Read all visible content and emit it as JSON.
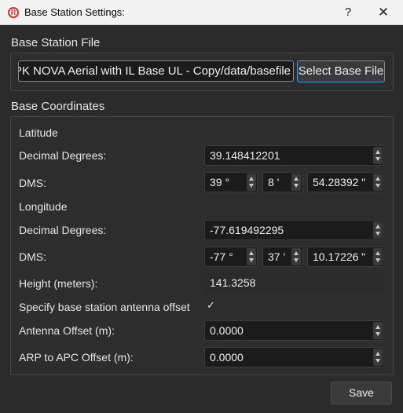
{
  "window": {
    "title": "Base Station Settings:",
    "help_glyph": "?",
    "close_glyph": "✕",
    "icon": "r-logo-icon"
  },
  "file_section": {
    "title": "Base Station File",
    "path": "PK NOVA Aerial with IL Base UL - Copy/data/basefile",
    "select_button": "Select Base File"
  },
  "coords": {
    "title": "Base Coordinates",
    "latitude": {
      "heading": "Latitude",
      "decimal_label": "Decimal Degrees:",
      "decimal_value": "39.148412201",
      "dms_label": "DMS:",
      "deg": "39 °",
      "min": "8 '",
      "sec": "54.28392 \""
    },
    "longitude": {
      "heading": "Longitude",
      "decimal_label": "Decimal Degrees:",
      "decimal_value": "-77.619492295",
      "dms_label": "DMS:",
      "deg": "-77 °",
      "min": "37 '",
      "sec": "10.17226 \""
    },
    "height_label": "Height (meters):",
    "height_value": "141.3258",
    "antenna_check_label": "Specify base station antenna offset",
    "antenna_check_mark": "✓",
    "antenna_offset_label": "Antenna Offset (m):",
    "antenna_offset_value": "0.0000",
    "arp_label": "ARP to APC Offset (m):",
    "arp_value": "0.0000"
  },
  "save_button": "Save",
  "colors": {
    "background": "#2b2b2b",
    "field": "#1b1b1b",
    "accent": "#4a9ad8",
    "brand": "#d92c2c"
  }
}
